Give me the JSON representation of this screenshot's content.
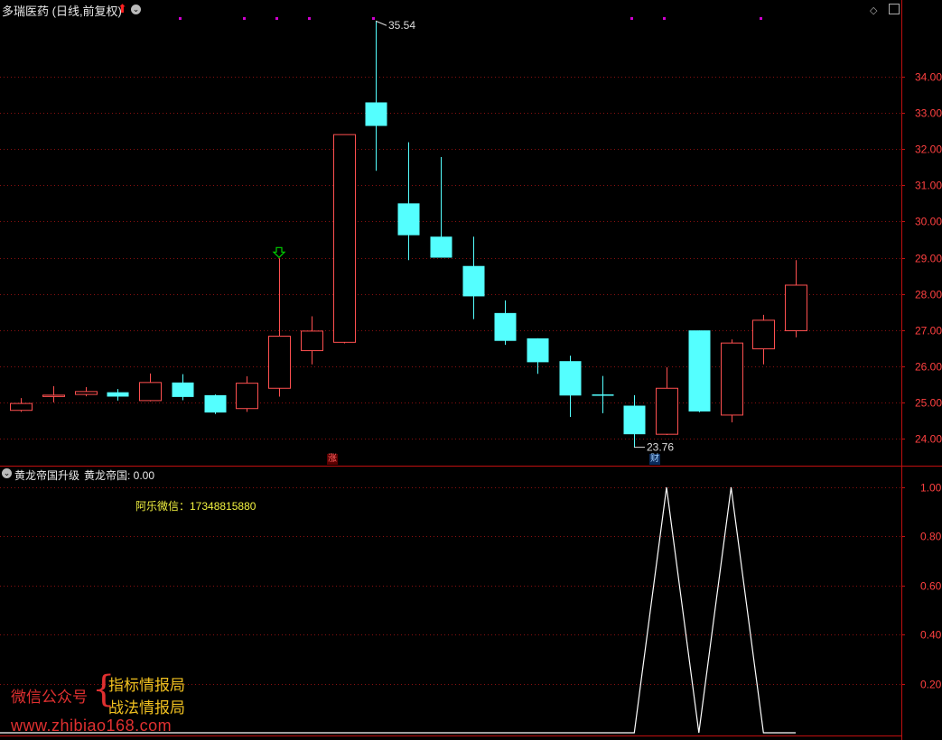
{
  "header": {
    "stock_title": "多瑞医药 (日线,前复权)",
    "indicator_title": "黄龙帝国升级",
    "indicator_value_label": "黄龙帝国: 0.00"
  },
  "annotations": {
    "wechat_contact": "阿乐微信：17348815880",
    "high_label": "35.54",
    "low_label": "23.76",
    "tag_zhang": "涨",
    "tag_cai": "财"
  },
  "watermark": {
    "left_text": "微信公众号",
    "right_line1": "指标情报局",
    "right_line2": "战法情报局",
    "url": "www.zhibiao168.com"
  },
  "colors": {
    "background": "#000000",
    "up": "#ff5050",
    "down": "#54ffff",
    "grid": "#8a1010",
    "axis": "#c01010",
    "axis_text": "#ff4040",
    "indicator_line": "#ffffff",
    "marker": "#d000d0",
    "arrow": "#00d000"
  },
  "chart_data": [
    {
      "type": "candlestick",
      "title": "多瑞医药 (日线,前复权)",
      "ylim": [
        23.6,
        35.9
      ],
      "yticks": [
        24.0,
        25.0,
        26.0,
        27.0,
        28.0,
        29.0,
        30.0,
        31.0,
        32.0,
        33.0,
        34.0
      ],
      "ytick_labels": [
        "24.00",
        "25.00",
        "26.00",
        "27.00",
        "28.00",
        "29.00",
        "30.00",
        "31.00",
        "32.00",
        "33.00",
        "34.00"
      ],
      "grid": true,
      "candles": [
        {
          "o": 24.78,
          "h": 25.12,
          "l": 24.74,
          "c": 24.97
        },
        {
          "o": 25.18,
          "h": 25.45,
          "l": 25.0,
          "c": 25.2
        },
        {
          "o": 25.22,
          "h": 25.42,
          "l": 25.17,
          "c": 25.3
        },
        {
          "o": 25.28,
          "h": 25.37,
          "l": 25.05,
          "c": 25.16
        },
        {
          "o": 25.05,
          "h": 25.8,
          "l": 25.03,
          "c": 25.55
        },
        {
          "o": 25.55,
          "h": 25.78,
          "l": 25.06,
          "c": 25.15
        },
        {
          "o": 25.2,
          "h": 25.22,
          "l": 24.68,
          "c": 24.72
        },
        {
          "o": 24.83,
          "h": 25.72,
          "l": 24.74,
          "c": 25.53
        },
        {
          "o": 25.39,
          "h": 28.98,
          "l": 25.16,
          "c": 26.83
        },
        {
          "o": 26.43,
          "h": 27.38,
          "l": 26.05,
          "c": 26.97
        },
        {
          "o": 26.66,
          "h": 32.4,
          "l": 26.63,
          "c": 32.4
        },
        {
          "o": 33.29,
          "h": 35.54,
          "l": 31.4,
          "c": 32.64
        },
        {
          "o": 30.5,
          "h": 32.19,
          "l": 28.93,
          "c": 29.62
        },
        {
          "o": 29.58,
          "h": 31.78,
          "l": 29.0,
          "c": 29.0
        },
        {
          "o": 28.77,
          "h": 29.58,
          "l": 27.3,
          "c": 27.93
        },
        {
          "o": 27.47,
          "h": 27.82,
          "l": 26.59,
          "c": 26.7
        },
        {
          "o": 26.77,
          "h": 26.77,
          "l": 25.79,
          "c": 26.11
        },
        {
          "o": 26.14,
          "h": 26.29,
          "l": 24.6,
          "c": 25.19
        },
        {
          "o": 25.22,
          "h": 25.73,
          "l": 24.7,
          "c": 25.19
        },
        {
          "o": 24.91,
          "h": 25.2,
          "l": 23.76,
          "c": 24.12
        },
        {
          "o": 24.12,
          "h": 25.97,
          "l": 24.1,
          "c": 25.39
        },
        {
          "o": 26.99,
          "h": 26.99,
          "l": 24.73,
          "c": 24.75
        },
        {
          "o": 24.65,
          "h": 26.74,
          "l": 24.45,
          "c": 26.64
        },
        {
          "o": 26.48,
          "h": 27.42,
          "l": 26.05,
          "c": 27.27
        },
        {
          "o": 26.98,
          "h": 28.93,
          "l": 26.8,
          "c": 28.24
        }
      ],
      "annotations": [
        {
          "text": "35.54",
          "candle": 11,
          "price": 35.54
        },
        {
          "text": "23.76",
          "candle": 19,
          "price": 23.76
        }
      ],
      "markers_top": [
        5,
        7,
        8,
        9,
        11,
        19,
        20,
        23
      ],
      "arrow_down_at": 8
    },
    {
      "type": "line",
      "title": "黄龙帝国升级",
      "series": [
        {
          "name": "黄龙帝国",
          "values": [
            0,
            0,
            0,
            0,
            0,
            0,
            0,
            0,
            0,
            0,
            0,
            0,
            0,
            0,
            0,
            0,
            0,
            0,
            0,
            0,
            1,
            0,
            1,
            0,
            0
          ]
        }
      ],
      "ylim": [
        0,
        1.0
      ],
      "yticks": [
        0.2,
        0.4,
        0.6,
        0.8,
        1.0
      ],
      "ytick_labels": [
        "0.20",
        "0.40",
        "0.60",
        "0.80",
        "1.00"
      ],
      "grid": true
    }
  ]
}
